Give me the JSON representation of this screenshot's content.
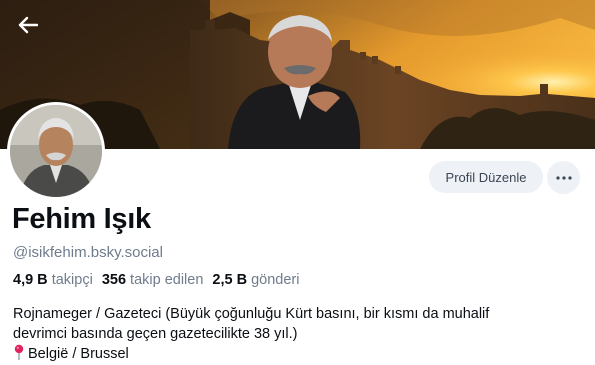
{
  "profile": {
    "display_name": "Fehim Işık",
    "handle": "@isikfehim.bsky.social",
    "stats": {
      "followers_value": "4,9 B",
      "followers_label": "takipçi",
      "following_value": "356",
      "following_label": "takip edilen",
      "posts_value": "2,5 B",
      "posts_label": "gönderi"
    },
    "bio_line1": "Rojnameger / Gazeteci (Büyük çoğunluğu Kürt basını, bir kısmı da muhalif",
    "bio_line2": "devrimci basında geçen gazetecilikte 38 yıl.)",
    "location": "België / Brussel",
    "location_icon": "pin-icon"
  },
  "actions": {
    "edit_profile_label": "Profil Düzenle",
    "more_icon": "ellipsis-icon",
    "back_icon": "arrow-left-icon"
  },
  "colors": {
    "button_bg": "#eef1f5",
    "muted_text": "#6f7c8b",
    "text": "#0b0f14"
  }
}
